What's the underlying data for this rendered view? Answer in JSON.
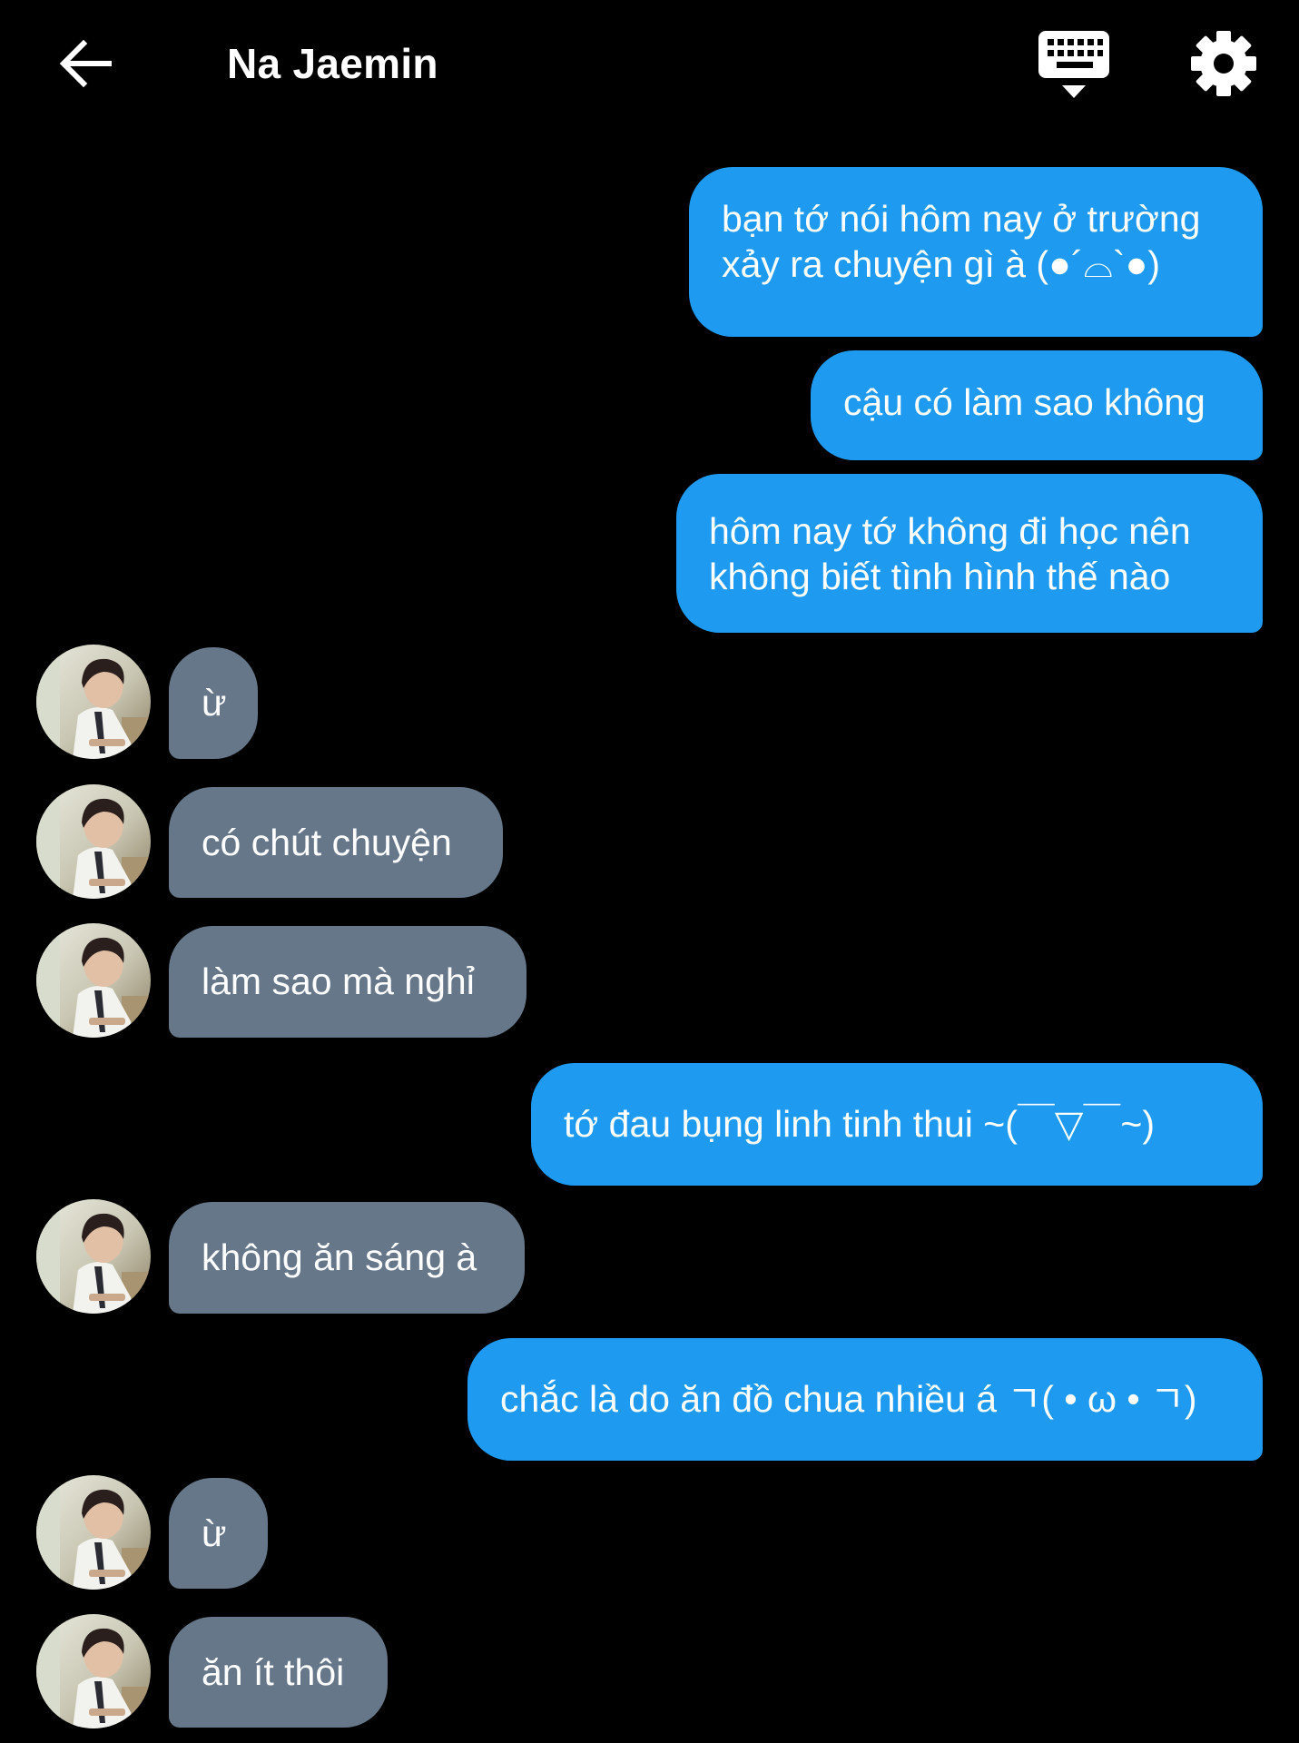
{
  "header": {
    "title": "Na Jaemin",
    "back_icon": "arrow-left-icon",
    "keyboard_icon": "keyboard-icon",
    "settings_icon": "gear-icon"
  },
  "colors": {
    "background": "#000000",
    "outgoing_bubble": "#1e9bf0",
    "incoming_bubble": "#66778a",
    "text": "#ffffff"
  },
  "messages": [
    {
      "side": "out",
      "text": "bạn tớ nói hôm nay ở trường\nxảy ra chuyện gì à (●´⌓`●)"
    },
    {
      "side": "out",
      "text": "cậu có làm sao không"
    },
    {
      "side": "out",
      "text": "hôm nay tớ không đi học nên\nkhông biết tình hình thế nào"
    },
    {
      "side": "in",
      "text": "ừ"
    },
    {
      "side": "in",
      "text": "có chút chuyện"
    },
    {
      "side": "in",
      "text": "làm sao mà nghỉ"
    },
    {
      "side": "out",
      "text": "tớ đau bụng linh tinh thui ~(￣▽￣~)"
    },
    {
      "side": "in",
      "text": "không ăn sáng à"
    },
    {
      "side": "out",
      "text": "chắc là do ăn đồ chua nhiều á ㄱ( • ω • ㄱ)"
    },
    {
      "side": "in",
      "text": "ừ"
    },
    {
      "side": "in",
      "text": "ăn ít thôi"
    }
  ]
}
